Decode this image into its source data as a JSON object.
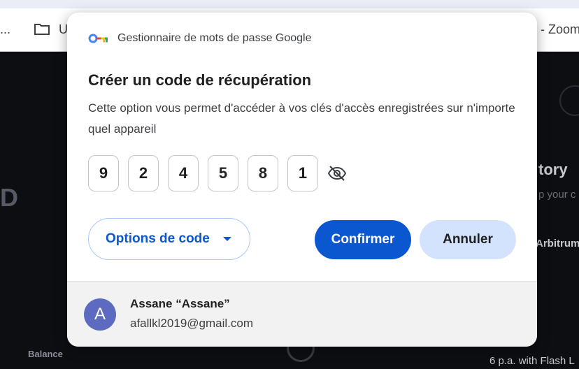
{
  "background": {
    "bookmarks_left": "...",
    "bookmark_u": "U",
    "bookmarks_right": "il - Zoom",
    "page_d": "D",
    "page_history": "tory",
    "page_your": "p your c",
    "page_arbitrum": "Arbitrum",
    "page_balance": "Balance",
    "page_flash": "6 p.a. with Flash L"
  },
  "dialog": {
    "app_name": "Gestionnaire de mots de passe Google",
    "title": "Créer un code de récupération",
    "description": "Cette option vous permet d'accéder à vos clés d'accès enregistrées sur n'importe quel appareil",
    "code_digits": [
      "9",
      "2",
      "4",
      "5",
      "8",
      "1"
    ],
    "eye_icon": "eye-off-icon",
    "options_label": "Options de code",
    "confirm_label": "Confirmer",
    "cancel_label": "Annuler",
    "account": {
      "avatar_letter": "A",
      "name": "Assane “Assane”",
      "email": "afallkl2019@gmail.com"
    }
  },
  "colors": {
    "primary": "#0b57d0",
    "secondary_button": "#d3e3fd",
    "avatar": "#5c6bc0"
  }
}
